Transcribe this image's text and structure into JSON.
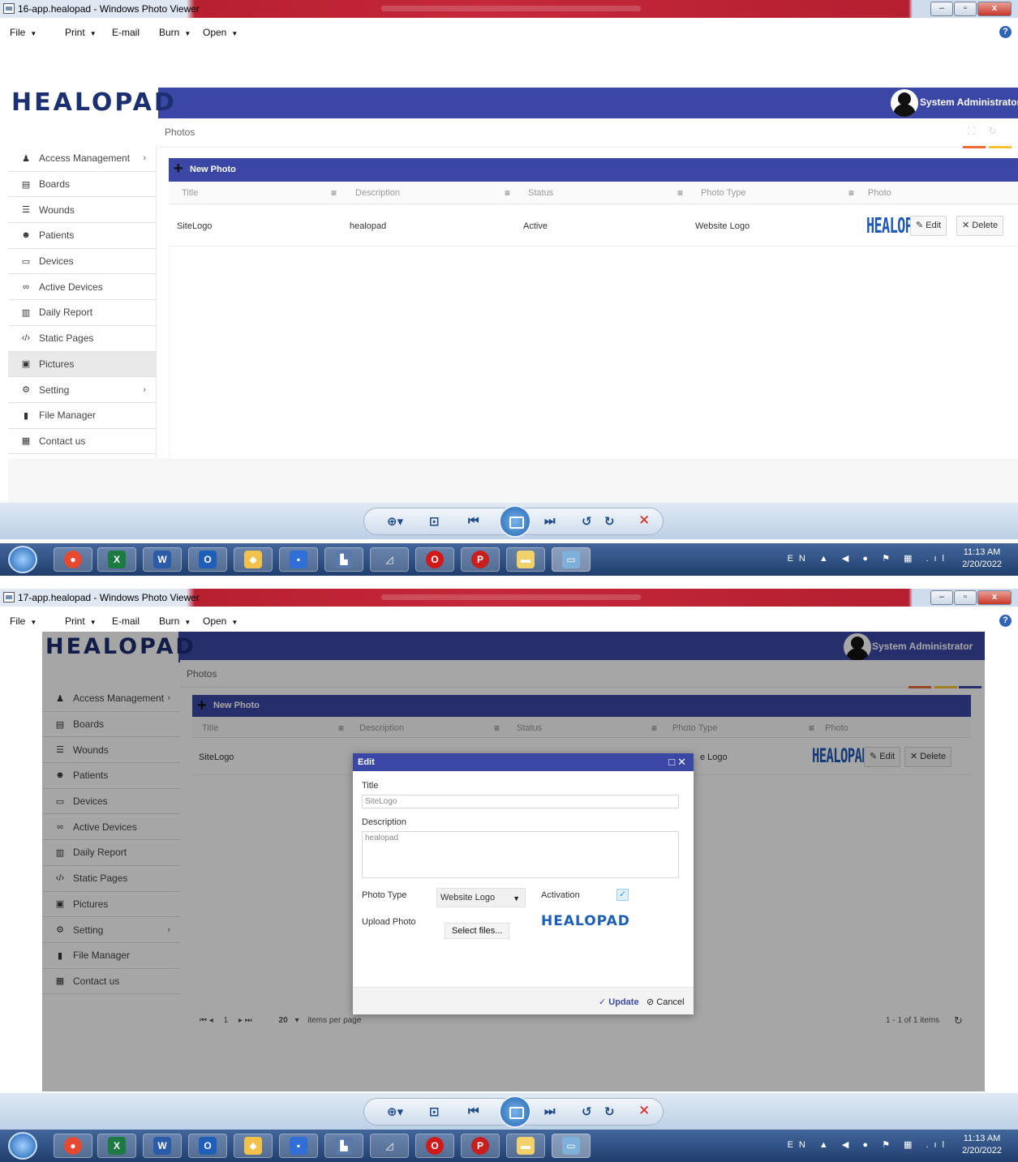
{
  "screen1": {
    "window_title": "16-app.healopad - Windows Photo Viewer",
    "menu": [
      "File",
      "Print",
      "E-mail",
      "Burn",
      "Open"
    ],
    "app": {
      "logo": "HEALOPAD",
      "user": "System Administrator",
      "breadcrumb": "Photos",
      "sidebar": [
        {
          "icon": "user-icon",
          "label": "Access Management",
          "has_submenu": true
        },
        {
          "icon": "board-icon",
          "label": "Boards"
        },
        {
          "icon": "wounds-icon",
          "label": "Wounds"
        },
        {
          "icon": "patients-icon",
          "label": "Patients"
        },
        {
          "icon": "device-icon",
          "label": "Devices"
        },
        {
          "icon": "binoculars-icon",
          "label": "Active Devices"
        },
        {
          "icon": "chart-icon",
          "label": "Daily Report"
        },
        {
          "icon": "code-icon",
          "label": "Static Pages"
        },
        {
          "icon": "picture-icon",
          "label": "Pictures",
          "active": true
        },
        {
          "icon": "gears-icon",
          "label": "Setting",
          "has_submenu": true
        },
        {
          "icon": "file-icon",
          "label": "File Manager"
        },
        {
          "icon": "contact-icon",
          "label": "Contact us"
        }
      ],
      "grid": {
        "new_button": "New Photo",
        "columns": [
          "Title",
          "Description",
          "Status",
          "Photo Type",
          "Photo"
        ],
        "rows": [
          {
            "title": "SiteLogo",
            "description": "healopad",
            "status": "Active",
            "photo_type": "Website Logo",
            "photo_logo": "HEALOPAD"
          }
        ],
        "edit_label": "Edit",
        "delete_label": "Delete"
      }
    },
    "clock": {
      "time": "11:13 AM",
      "date": "2/20/2022"
    },
    "lang": "EN"
  },
  "screen2": {
    "window_title": "17-app.healopad - Windows Photo Viewer",
    "menu": [
      "File",
      "Print",
      "E-mail",
      "Burn",
      "Open"
    ],
    "background_row_title": "SiteLogo",
    "background_row_photo_type": "e Logo",
    "pager": {
      "page": "1",
      "page_size": "20",
      "items_per_page": "items per page",
      "summary": "1 - 1 of 1 items"
    },
    "dialog": {
      "title": "Edit",
      "title_label": "Title",
      "title_value": "SiteLogo",
      "description_label": "Description",
      "description_value": "healopad",
      "photo_type_label": "Photo Type",
      "photo_type_value": "Website Logo",
      "activation_label": "Activation",
      "activation_checked": true,
      "upload_label": "Upload Photo",
      "select_files": "Select files...",
      "preview_logo": "HEALOPAD",
      "update": "Update",
      "cancel": "Cancel"
    },
    "clock": {
      "time": "11:13 AM",
      "date": "2/20/2022"
    },
    "lang": "EN"
  },
  "colors": {
    "brand_blue": "#3b47a5",
    "logo_navy": "#1c2f70",
    "titlebar_red": "#c4283a",
    "accent_orange": "#f06a3a",
    "accent_yellow": "#f4c430"
  }
}
